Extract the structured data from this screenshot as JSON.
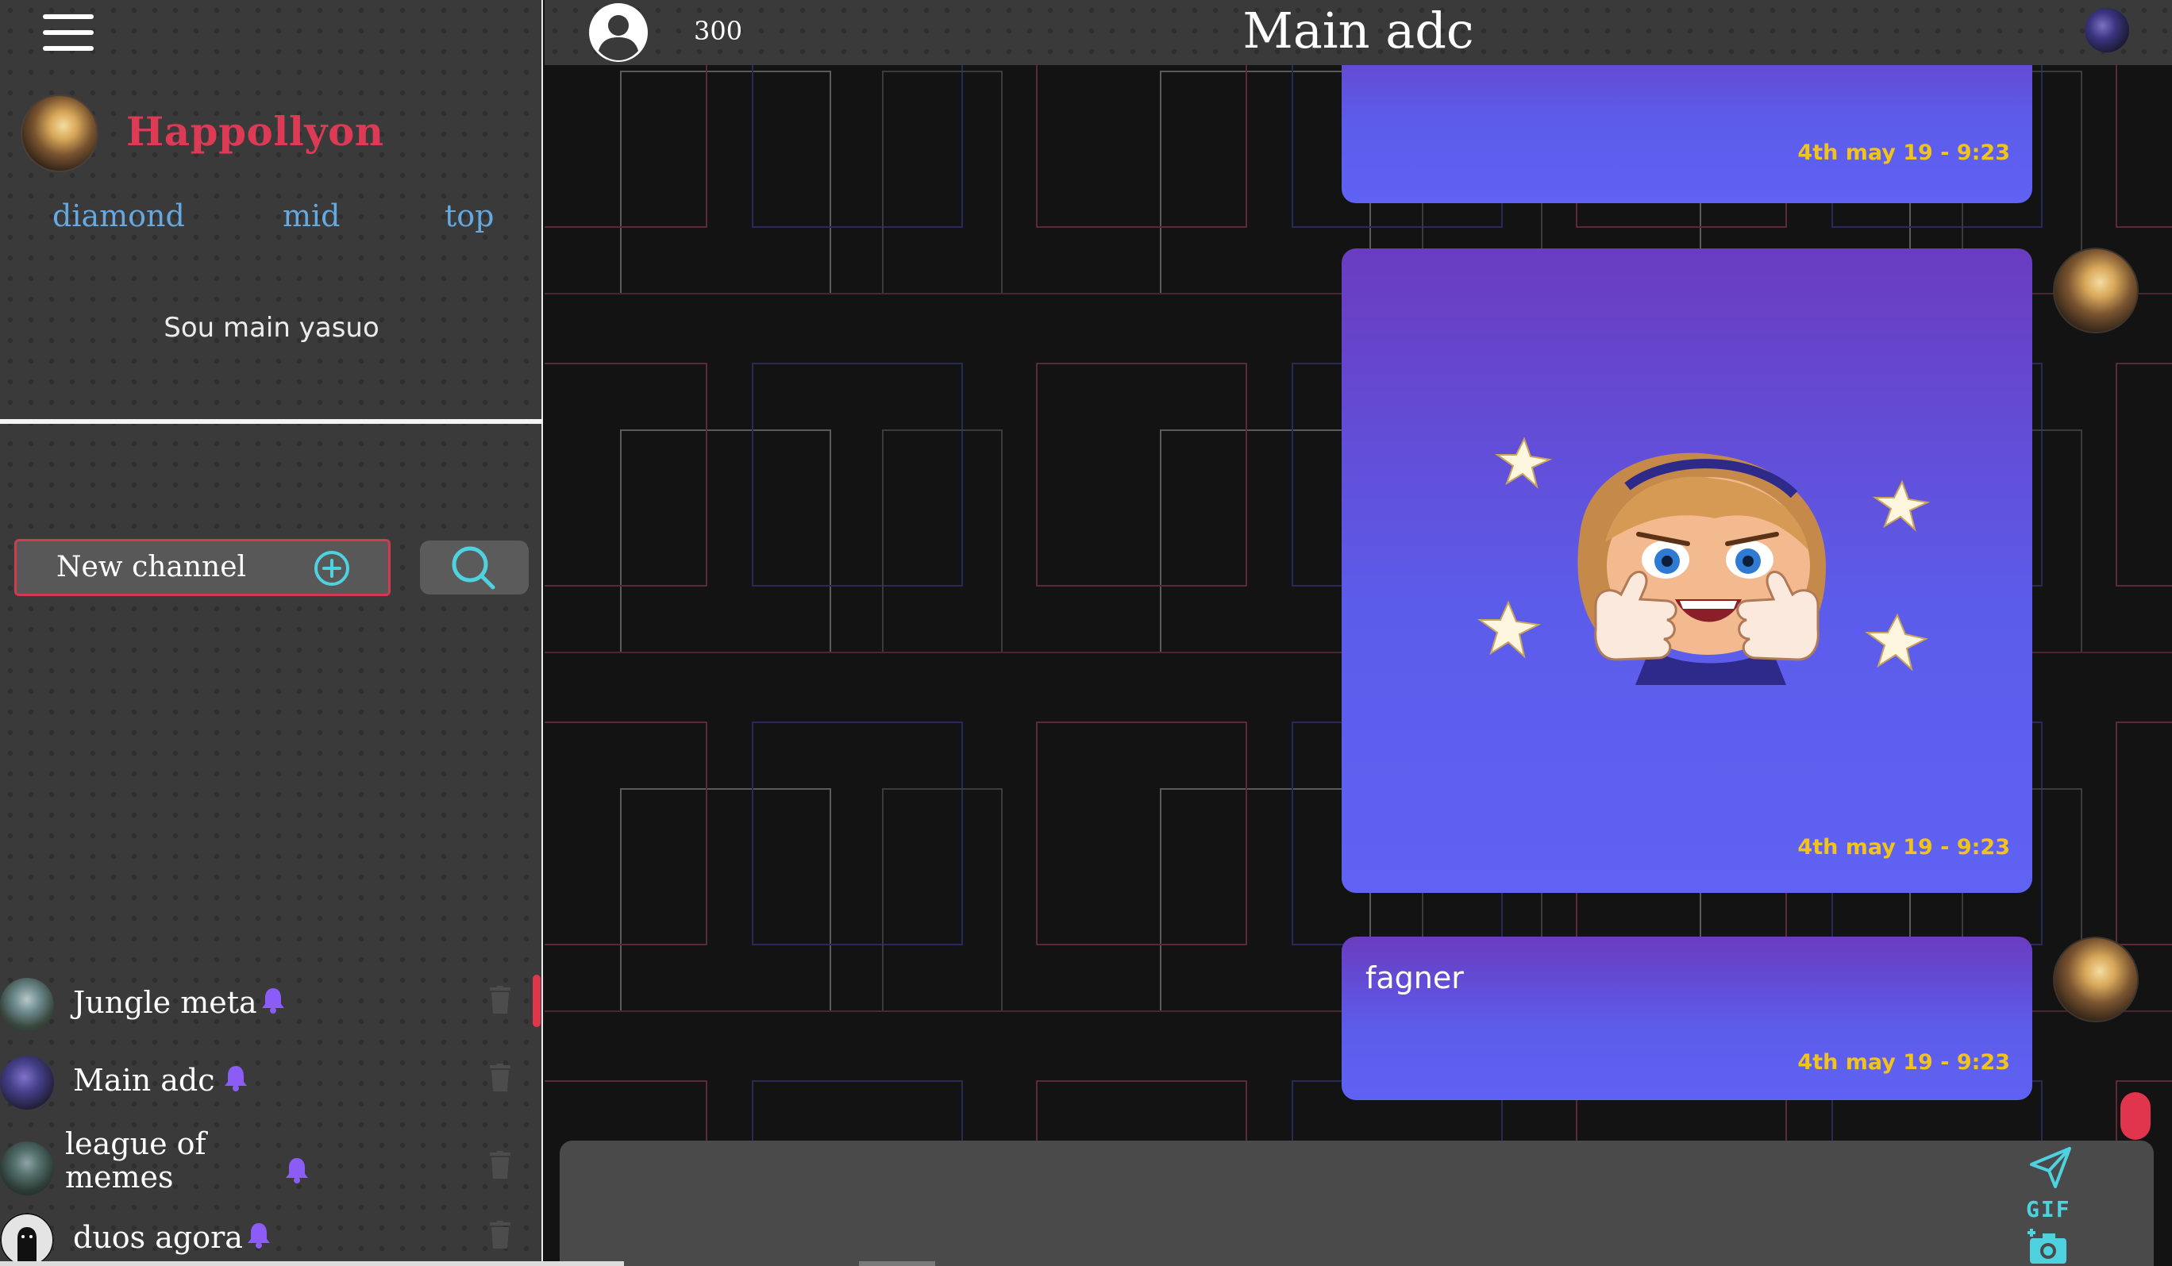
{
  "profile": {
    "name": "Happollyon",
    "tags": [
      "diamond",
      "mid",
      "top"
    ],
    "bio": "Sou main yasuo"
  },
  "sidebar": {
    "new_channel_label": "New channel",
    "channels": [
      {
        "name": "Jungle meta",
        "active": true
      },
      {
        "name": "Main adc",
        "active": false
      },
      {
        "name": "league of memes",
        "active": false
      },
      {
        "name": "duos agora",
        "active": false
      }
    ]
  },
  "header": {
    "points": "300",
    "title": "Main adc"
  },
  "messages": [
    {
      "type": "text",
      "text": "",
      "timestamp": "4th may 19 - 9:23"
    },
    {
      "type": "sticker",
      "timestamp": "4th may 19 - 9:23"
    },
    {
      "type": "text",
      "text": "fagner",
      "timestamp": "4th may 19 - 9:23"
    }
  ],
  "composer": {
    "gif_label": "GIF",
    "value": ""
  },
  "colors": {
    "accent_red": "#dc3a55",
    "tag_blue": "#66a8e0",
    "timestamp_yellow": "#f2c419",
    "bubble_purple": "#5f62f2",
    "icon_cyan": "#4fd2df",
    "bell_purple": "#8b5cf6"
  },
  "icons": {
    "menu": "hamburger-icon",
    "add": "plus-circle-icon",
    "search": "search-icon",
    "user": "user-circle-icon",
    "bell": "bell-icon",
    "trash": "trash-icon",
    "send": "send-icon",
    "camera": "camera-add-icon"
  }
}
